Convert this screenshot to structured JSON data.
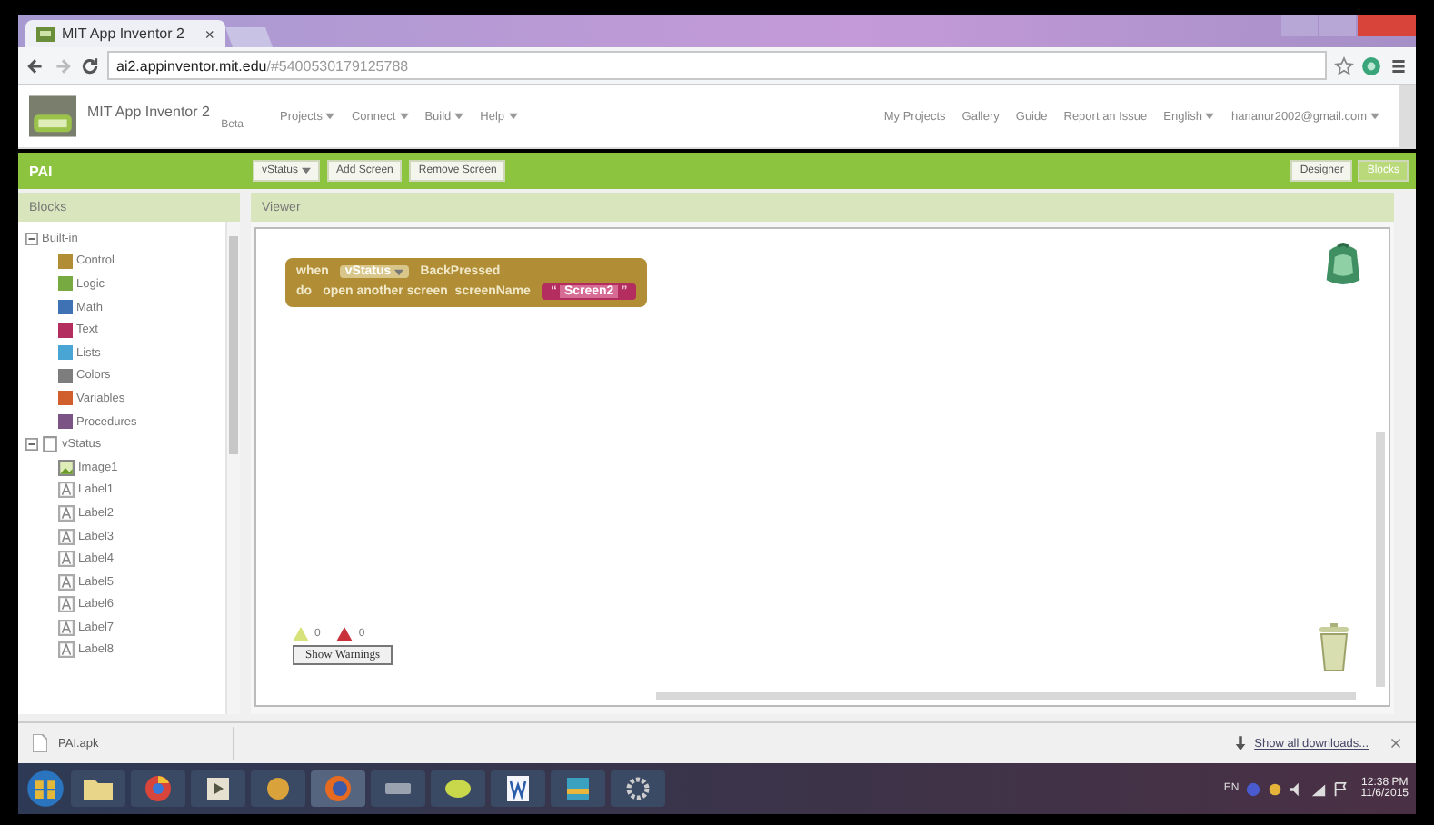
{
  "browser": {
    "tab_title": "MIT App Inventor 2",
    "tab_close": "×",
    "url_host": "ai2.appinventor.mit.edu",
    "url_rest": "/#5400530179125788"
  },
  "header": {
    "title": "MIT App Inventor 2",
    "subtitle": "Beta",
    "menus": [
      "Projects",
      "Connect",
      "Build",
      "Help"
    ],
    "links": [
      {
        "label": "My Projects",
        "caret": false
      },
      {
        "label": "Gallery",
        "caret": false
      },
      {
        "label": "Guide",
        "caret": false
      },
      {
        "label": "Report an Issue",
        "caret": false
      },
      {
        "label": "English",
        "caret": true
      },
      {
        "label": "hananur2002@gmail.com",
        "caret": true
      }
    ]
  },
  "project_bar": {
    "name": "PAI",
    "screen": "vStatus",
    "buttons": [
      "Add Screen",
      "Remove Screen"
    ],
    "views": [
      {
        "label": "Designer",
        "selected": false
      },
      {
        "label": "Blocks",
        "selected": true
      }
    ]
  },
  "blocks_panel": {
    "title": "Blocks",
    "tree": [
      {
        "label": "Built-in",
        "expanded": true,
        "children": [
          {
            "label": "Control",
            "color": "#b18e35"
          },
          {
            "label": "Logic",
            "color": "#77ab41"
          },
          {
            "label": "Math",
            "color": "#3f71b5"
          },
          {
            "label": "Text",
            "color": "#b32d5e"
          },
          {
            "label": "Lists",
            "color": "#49a6d4"
          },
          {
            "label": "Colors",
            "color": "#7d7d7d"
          },
          {
            "label": "Variables",
            "color": "#d05f2d"
          },
          {
            "label": "Procedures",
            "color": "#7c5385"
          }
        ]
      },
      {
        "label": "vStatus",
        "expanded": true,
        "children": [
          {
            "label": "Image1",
            "kind": "image"
          },
          {
            "label": "Label1",
            "kind": "label"
          },
          {
            "label": "Label2",
            "kind": "label"
          },
          {
            "label": "Label3",
            "kind": "label"
          },
          {
            "label": "Label4",
            "kind": "label"
          },
          {
            "label": "Label5",
            "kind": "label"
          },
          {
            "label": "Label6",
            "kind": "label"
          },
          {
            "label": "Label7",
            "kind": "label"
          },
          {
            "label": "Label8",
            "kind": "label"
          }
        ]
      }
    ]
  },
  "viewer": {
    "title": "Viewer",
    "event": {
      "when": "when",
      "component": "vStatus",
      "event": "BackPressed",
      "do": "do",
      "call": "open another screen  screenName",
      "text_open": "“",
      "text": "Screen2",
      "text_close": "”"
    },
    "warnings": "0",
    "errors": "0",
    "show_warnings": "Show Warnings"
  },
  "downloads": {
    "file": "PAI.apk",
    "show_all": "Show all downloads..."
  },
  "taskbar": {
    "time": "12:38 PM",
    "date": "11/6/2015",
    "lang": "EN"
  }
}
